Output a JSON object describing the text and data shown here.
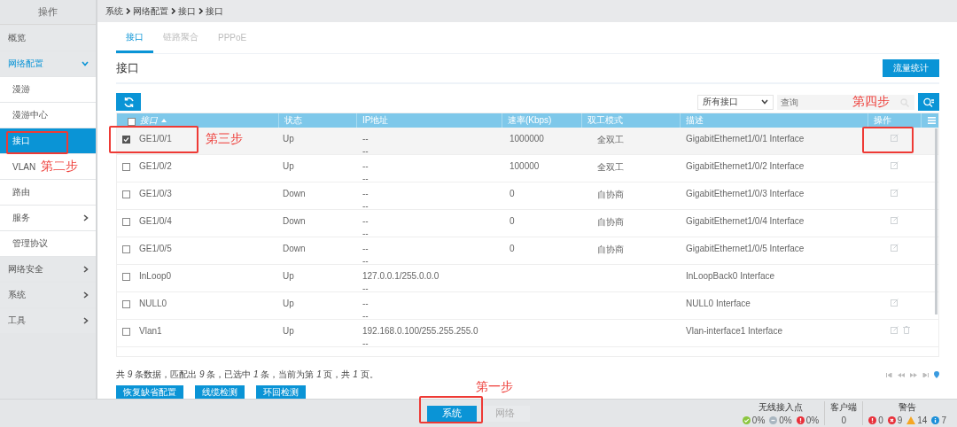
{
  "sidebar": {
    "title": "操作",
    "items": [
      {
        "label": "概览",
        "kind": "link",
        "selected": false
      },
      {
        "label": "网络配置",
        "kind": "group",
        "expanded": true,
        "children": [
          {
            "label": "漫游",
            "kind": "link",
            "selected": false
          },
          {
            "label": "漫游中心",
            "kind": "link",
            "selected": false
          },
          {
            "label": "接口",
            "kind": "link",
            "selected": true
          },
          {
            "label": "VLAN",
            "kind": "link",
            "selected": false
          },
          {
            "label": "路由",
            "kind": "link",
            "selected": false
          },
          {
            "label": "服务",
            "kind": "group",
            "expanded": false
          },
          {
            "label": "管理协议",
            "kind": "link",
            "selected": false
          }
        ]
      },
      {
        "label": "网络安全",
        "kind": "group",
        "expanded": false
      },
      {
        "label": "系统",
        "kind": "group",
        "expanded": false
      },
      {
        "label": "工具",
        "kind": "group",
        "expanded": false
      }
    ]
  },
  "breadcrumb": [
    "系统",
    "网络配置",
    "接口",
    "接口"
  ],
  "tabs": [
    {
      "label": "接口",
      "selected": true
    },
    {
      "label": "链路聚合",
      "selected": false
    },
    {
      "label": "PPPoE",
      "selected": false
    }
  ],
  "section_title": "接口",
  "traffic_button": "流量统计",
  "filter": {
    "value": "所有接口"
  },
  "search": {
    "placeholder": "查询"
  },
  "table": {
    "all_checked": false,
    "columns": [
      {
        "label": "接口",
        "sorted": true
      },
      {
        "label": "状态",
        "sorted": false
      },
      {
        "label": "IP地址",
        "sorted": false
      },
      {
        "label": "速率(Kbps)",
        "sorted": false
      },
      {
        "label": "双工模式",
        "sorted": false
      },
      {
        "label": "描述",
        "sorted": false
      },
      {
        "label": "操作",
        "sorted": false
      }
    ],
    "rows": [
      {
        "checked": true,
        "interface": "GE1/0/1",
        "status": "Up",
        "ip_lines": [
          "--",
          "--"
        ],
        "rate": "1000000",
        "duplex": "全双工",
        "description": "GigabitEthernet1/0/1 Interface",
        "editable": true,
        "deletable": false
      },
      {
        "checked": false,
        "interface": "GE1/0/2",
        "status": "Up",
        "ip_lines": [
          "--",
          "--"
        ],
        "rate": "100000",
        "duplex": "全双工",
        "description": "GigabitEthernet1/0/2 Interface",
        "editable": true,
        "deletable": false
      },
      {
        "checked": false,
        "interface": "GE1/0/3",
        "status": "Down",
        "ip_lines": [
          "--",
          "--"
        ],
        "rate": "0",
        "duplex": "自协商",
        "description": "GigabitEthernet1/0/3 Interface",
        "editable": true,
        "deletable": false
      },
      {
        "checked": false,
        "interface": "GE1/0/4",
        "status": "Down",
        "ip_lines": [
          "--",
          "--"
        ],
        "rate": "0",
        "duplex": "自协商",
        "description": "GigabitEthernet1/0/4 Interface",
        "editable": true,
        "deletable": false
      },
      {
        "checked": false,
        "interface": "GE1/0/5",
        "status": "Down",
        "ip_lines": [
          "--",
          "--"
        ],
        "rate": "0",
        "duplex": "自协商",
        "description": "GigabitEthernet1/0/5 Interface",
        "editable": true,
        "deletable": false
      },
      {
        "checked": false,
        "interface": "InLoop0",
        "status": "Up",
        "ip_lines": [
          "127.0.0.1/255.0.0.0",
          "--"
        ],
        "description": "InLoopBack0 Interface",
        "editable": false,
        "deletable": false
      },
      {
        "checked": false,
        "interface": "NULL0",
        "status": "Up",
        "ip_lines": [
          "--",
          "--"
        ],
        "description": "NULL0 Interface",
        "editable": true,
        "deletable": false
      },
      {
        "checked": false,
        "interface": "Vlan1",
        "status": "Up",
        "ip_lines": [
          "192.168.0.100/255.255.255.0",
          "--"
        ],
        "description": "Vlan-interface1 Interface",
        "editable": true,
        "deletable": true
      }
    ]
  },
  "summary": "共 *9* 条数据，匹配出 *9* 条，已选中 *1* 条，当前为第 *1* 页，共 *1* 页。",
  "actions": [
    "恢复缺省配置",
    "线缆检测",
    "环回检测"
  ],
  "bottom_bar": {
    "modes": [
      {
        "label": "系统",
        "selected": true
      },
      {
        "label": "网络",
        "selected": false
      }
    ],
    "access_points": {
      "title": "无线接入点",
      "items": [
        {
          "kind": "ok",
          "value": "0%"
        },
        {
          "kind": "offline",
          "value": "0%"
        },
        {
          "kind": "error",
          "value": "0%"
        }
      ]
    },
    "clients": {
      "title": "客户端",
      "value": "0"
    },
    "alarms": {
      "title": "警告",
      "items": [
        {
          "kind": "critical",
          "value": "0"
        },
        {
          "kind": "major",
          "value": "9"
        },
        {
          "kind": "warning",
          "value": "14"
        },
        {
          "kind": "info",
          "value": "7"
        }
      ]
    }
  },
  "annotations": [
    {
      "label": "第二步"
    },
    {
      "label": "第三步"
    },
    {
      "label": "第四步"
    },
    {
      "label": "第一步"
    }
  ]
}
